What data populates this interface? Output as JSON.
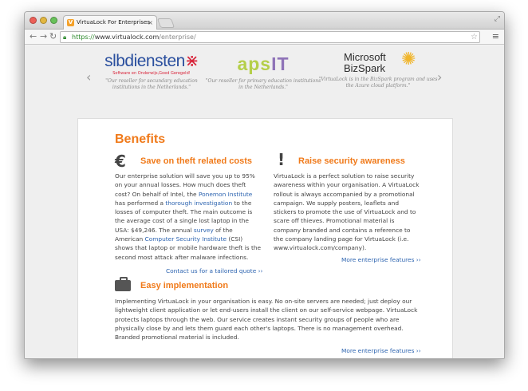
{
  "browser": {
    "tab_title": "VirtuaLock For Enterprises",
    "favicon_letter": "V",
    "tab_close": "×",
    "url_scheme": "https://",
    "url_host": "www.virtualock.com",
    "url_path": "/enterprise/"
  },
  "partners": {
    "prev": "‹",
    "next": "›",
    "items": [
      {
        "logo": "slbdiensten",
        "logo_sub": "Software en Onderwijs,Goed Geregeld!",
        "caption": "\"Our reseller for secundary education institutions in the Netherlands.\""
      },
      {
        "logo": "apsIT",
        "caption": "\"Our reseller for primary education institutions in the Netherlands.\""
      },
      {
        "logo_line1": "Microsoft",
        "logo_line2": "BizSpark",
        "caption": "\"VirtuaLock is in the BizSpark program and uses the Azure cloud platform.\""
      }
    ]
  },
  "benefits": {
    "title": "Benefits",
    "theft": {
      "icon_glyph": "€",
      "heading": "Save on theft related costs",
      "p1": "Our enterprise solution will save you up to 95% on your annual losses. How much does theft cost? On behalf of Intel, the ",
      "link1": "Ponemon Institute",
      "p2": " has performed a ",
      "link2": "thorough investigation",
      "p3": " to the losses of computer theft. The main outcome is the average cost of a single lost laptop in the USA: $49,246. The annual ",
      "link3": "survey",
      "p4": " of the American ",
      "link4": "Computer Security Institute",
      "p5": " (CSI) shows that laptop or mobile hardware theft is the second most attack after malware infections.",
      "cta": "Contact us for a tailored quote ››"
    },
    "security": {
      "icon_glyph": "!",
      "heading": "Raise security awareness",
      "text": "VirtuaLock is a perfect solution to raise security awareness within your organisation. A VirtuaLock rollout is always accompanied by a promotional campaign. We supply posters, leaflets and stickers to promote the use of VirtuaLock and to scare off thieves. Promotional material is company branded and contains a reference to the company landing page for VirtuaLock (i.e. www.virtualock.com/company).",
      "more": "More enterprise features ››"
    },
    "implementation": {
      "heading": "Easy implementation",
      "text": "Implementing VirtuaLock in your organisation is easy. No on-site servers are needed; just deploy our lightweight client application or let end-users install the client on our self-service webpage. VirtuaLock protects laptops through the web. Our service creates instant security groups of people who are physically close by and lets them guard each other's laptops. There is no management overhead. Branded promotional material is included.",
      "more": "More enterprise features ››"
    }
  },
  "colors": {
    "accent": "#f07a1a",
    "link": "#2d64b0"
  }
}
